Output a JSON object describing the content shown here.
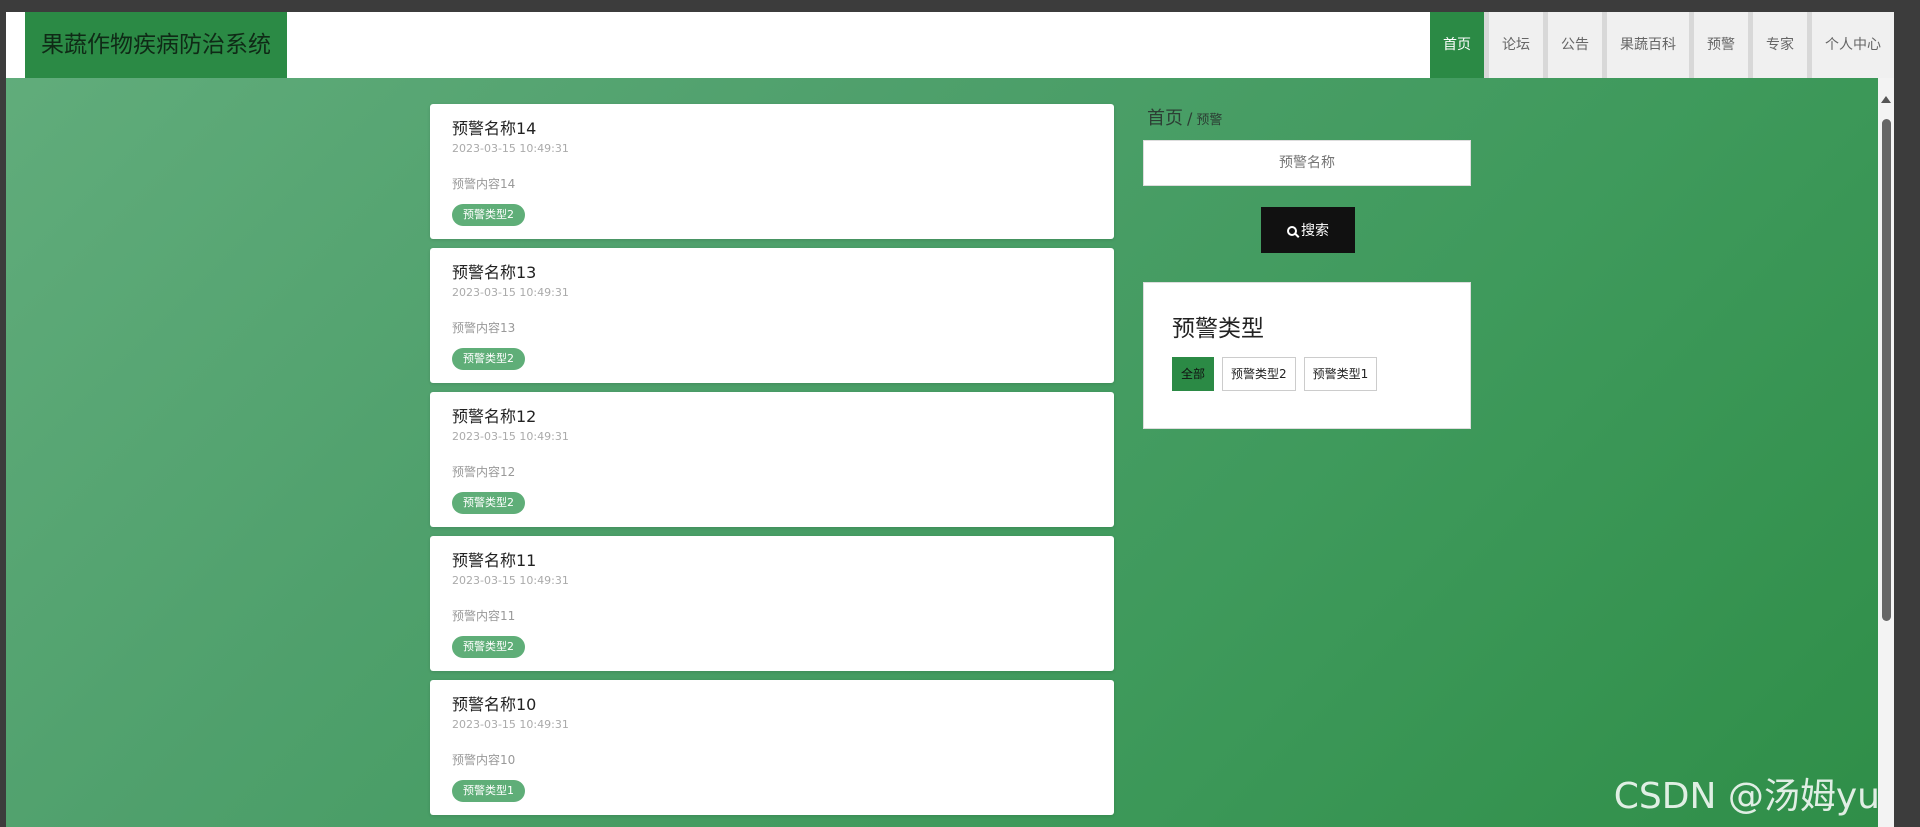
{
  "app": {
    "title": "果蔬作物疾病防治系统"
  },
  "nav": [
    {
      "label": "首页",
      "active": true
    },
    {
      "label": "论坛"
    },
    {
      "label": "公告"
    },
    {
      "label": "果蔬百科"
    },
    {
      "label": "预警"
    },
    {
      "label": "专家"
    },
    {
      "label": "个人中心"
    }
  ],
  "list": [
    {
      "title": "预警名称14",
      "time": "2023-03-15 10:49:31",
      "content": "预警内容14",
      "type": "预警类型2"
    },
    {
      "title": "预警名称13",
      "time": "2023-03-15 10:49:31",
      "content": "预警内容13",
      "type": "预警类型2"
    },
    {
      "title": "预警名称12",
      "time": "2023-03-15 10:49:31",
      "content": "预警内容12",
      "type": "预警类型2"
    },
    {
      "title": "预警名称11",
      "time": "2023-03-15 10:49:31",
      "content": "预警内容11",
      "type": "预警类型2"
    },
    {
      "title": "预警名称10",
      "time": "2023-03-15 10:49:31",
      "content": "预警内容10",
      "type": "预警类型1"
    }
  ],
  "breadcrumb": {
    "home": "首页",
    "separator": "/",
    "current": "预警"
  },
  "search": {
    "placeholder": "预警名称",
    "button": "搜索"
  },
  "types": {
    "title": "预警类型",
    "items": [
      {
        "label": "全部",
        "active": true
      },
      {
        "label": "预警类型2"
      },
      {
        "label": "预警类型1"
      }
    ]
  },
  "watermark": "CSDN @汤姆yu",
  "colors": {
    "primary": "#2b8a45",
    "badge": "#5fae78",
    "button_dark": "#111111"
  }
}
